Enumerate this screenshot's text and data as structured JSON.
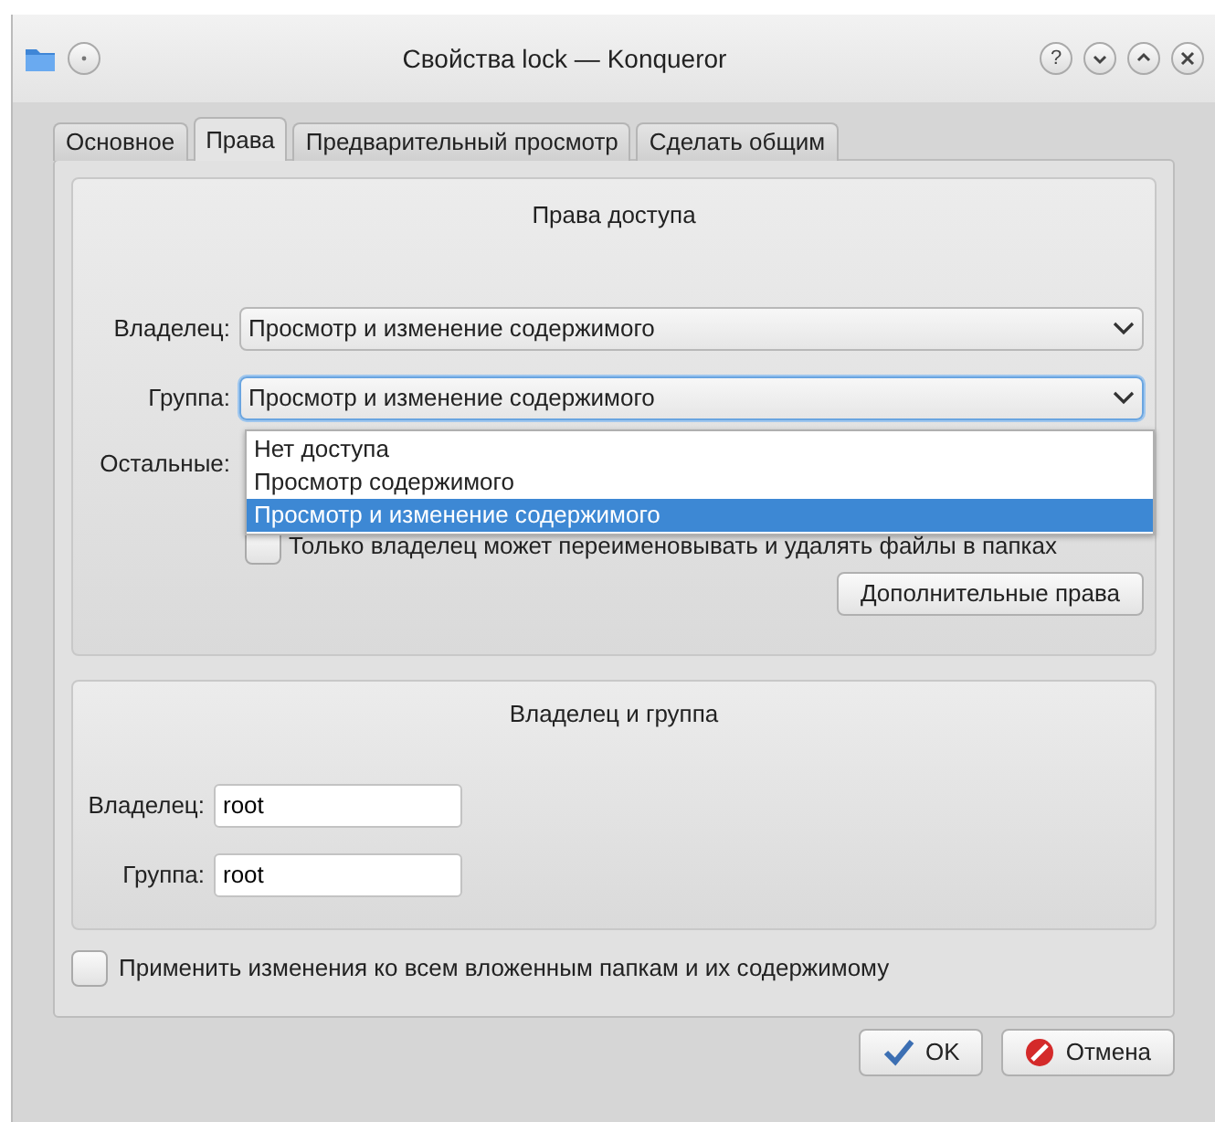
{
  "window": {
    "title": "Свойства lock — Konqueror",
    "help_button": "?"
  },
  "tabs": [
    {
      "label": "Основное",
      "selected": false
    },
    {
      "label": "Права",
      "selected": true
    },
    {
      "label": "Предварительный просмотр",
      "selected": false
    },
    {
      "label": "Сделать общим",
      "selected": false
    }
  ],
  "access": {
    "title": "Права доступа",
    "rows": [
      {
        "label": "Владелец:",
        "value": "Просмотр и изменение содержимого",
        "focused": false
      },
      {
        "label": "Группа:",
        "value": "Просмотр и изменение содержимого",
        "focused": true
      },
      {
        "label": "Остальные:"
      }
    ],
    "dropdown": [
      {
        "label": "Нет доступа",
        "selected": false
      },
      {
        "label": "Просмотр содержимого",
        "selected": false
      },
      {
        "label": "Просмотр и изменение содержимого",
        "selected": true
      }
    ],
    "owner_only_checkbox": {
      "label": "Только владелец может переименовывать и удалять файлы в папках",
      "checked": false
    },
    "advanced_button": "Дополнительные права"
  },
  "ownership": {
    "title": "Владелец и группа",
    "fields": [
      {
        "label": "Владелец:",
        "value": "root"
      },
      {
        "label": "Группа:",
        "value": "root"
      }
    ]
  },
  "recursive_checkbox": {
    "label": "Применить изменения ко всем вложенным папкам и их содержимому",
    "checked": false
  },
  "buttons": [
    {
      "label": "OK",
      "kind": "ok"
    },
    {
      "label": "Отмена",
      "kind": "cancel"
    }
  ]
}
